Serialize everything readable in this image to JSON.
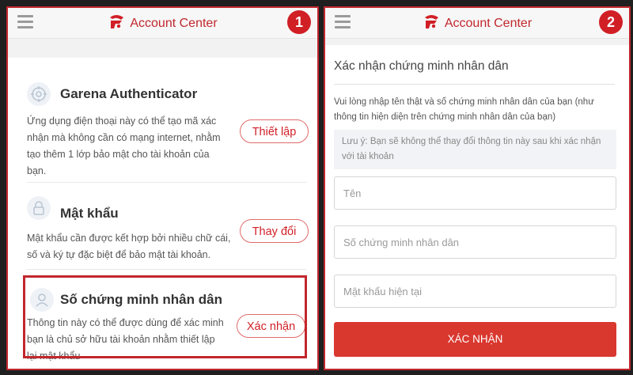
{
  "app": {
    "brand_name": "Account Center",
    "accent_color": "#d11f26"
  },
  "panel_1": {
    "step_number": "1",
    "sections": [
      {
        "icon": "shield-icon",
        "title": "Garena Authenticator",
        "description": "Ứng dụng điện thoại này có thể tạo mã xác nhận mà không cần có mạng internet, nhằm tạo thêm 1 lớp bảo mật cho tài khoản của bạn.",
        "button_label": "Thiết lập"
      },
      {
        "icon": "lock-icon",
        "title": "Mật khẩu",
        "description": "Mật khẩu cần được kết hợp bởi nhiều chữ cái, số và ký tự đặc biệt để bảo mật tài khoản.",
        "button_label": "Thay đổi"
      },
      {
        "icon": "user-icon",
        "title": "Số chứng minh nhân dân",
        "description": "Thông tin này có thể được dùng để xác minh bạn là chủ sở hữu tài khoản nhằm thiết lập lại mật khẩu",
        "button_label": "Xác nhận"
      }
    ]
  },
  "panel_2": {
    "step_number": "2",
    "heading": "Xác nhận chứng minh nhân dân",
    "instruction": "Vui lòng nhập tên thật và số chứng minh nhân dân của bạn (như thông tin hiện diện trên chứng minh nhân dân của bạn)",
    "note_label": "Lưu ý:",
    "note_text": " Bạn sẽ không thể thay đổi thông tin này sau khi xác nhận với tài khoản",
    "fields": {
      "name_placeholder": "Tên",
      "id_number_placeholder": "Số chứng minh nhân dân",
      "password_placeholder": "Mật khẩu hiện tại"
    },
    "submit_label": "XÁC NHẬN"
  }
}
